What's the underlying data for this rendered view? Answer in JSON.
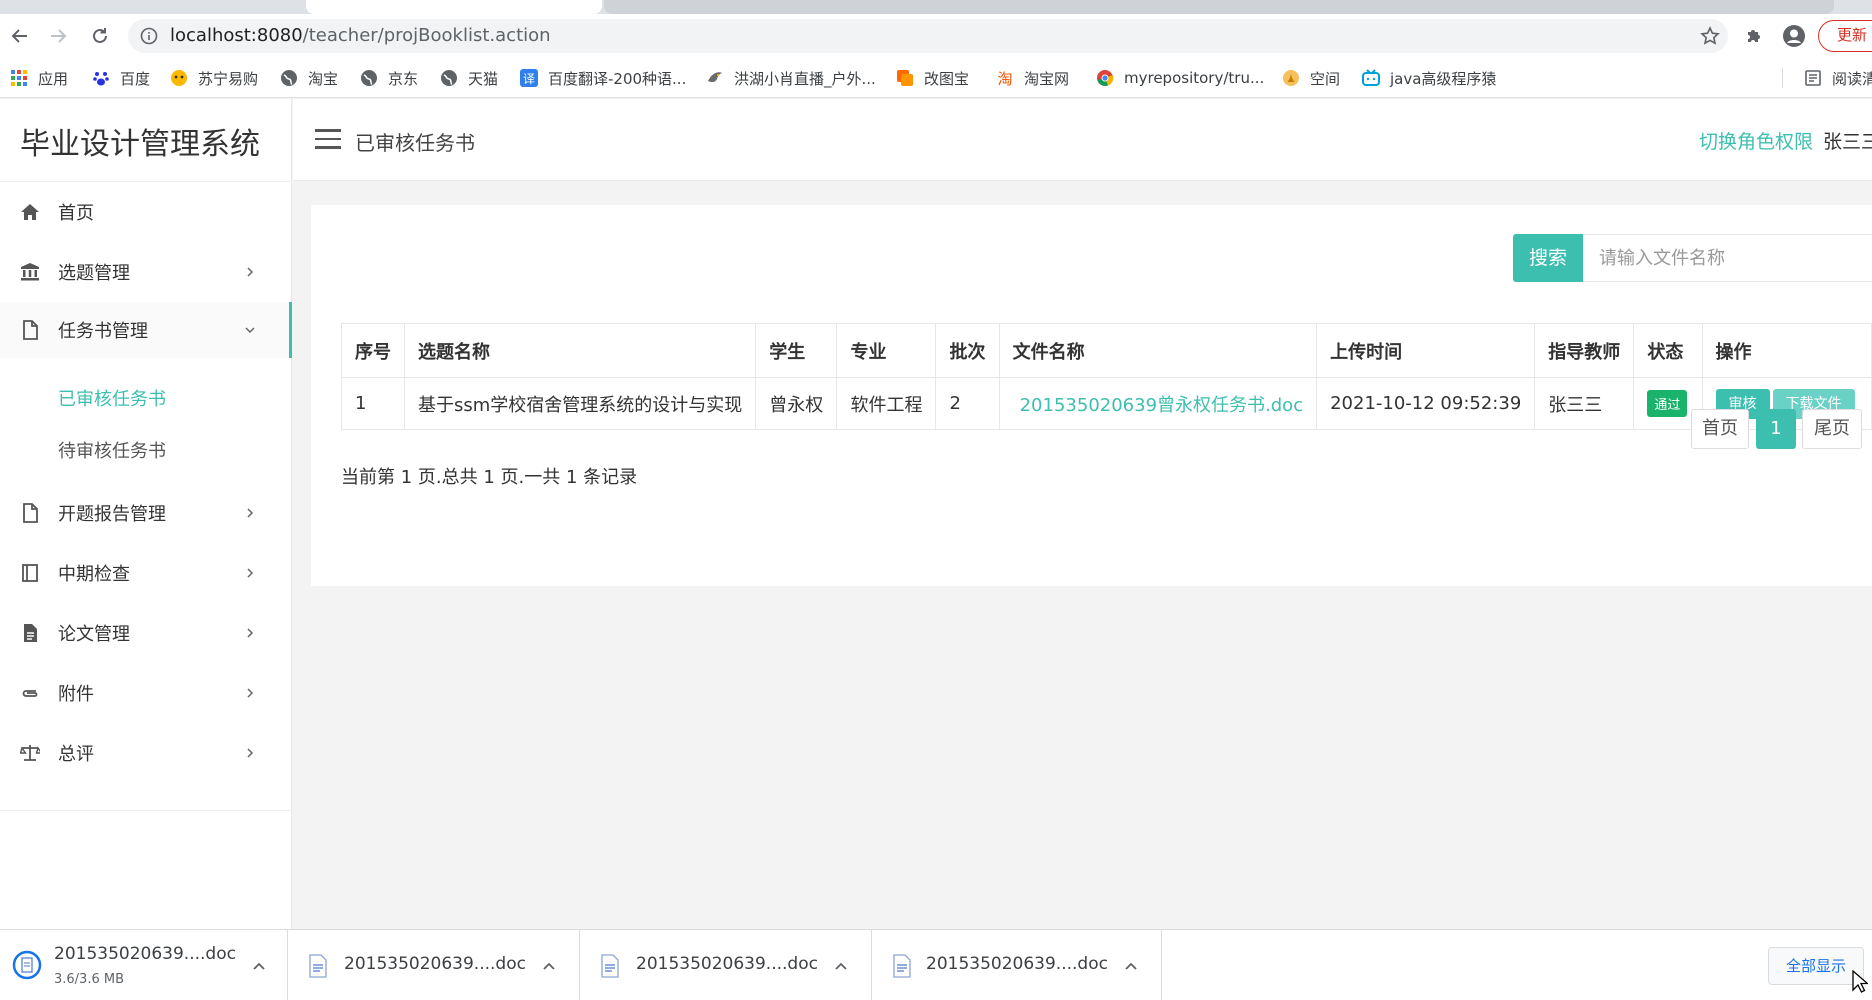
{
  "browser": {
    "url_host": "localhost:8080",
    "url_path": "/teacher/projBooklist.action",
    "update_label": "更新",
    "bookmarks": [
      {
        "label": "应用",
        "icon": "apps-grid-icon"
      },
      {
        "label": "百度",
        "icon": "baidu-paw-icon"
      },
      {
        "label": "苏宁易购",
        "icon": "suning-icon"
      },
      {
        "label": "淘宝",
        "icon": "globe-icon"
      },
      {
        "label": "京东",
        "icon": "globe-icon"
      },
      {
        "label": "天猫",
        "icon": "globe-icon"
      },
      {
        "label": "百度翻译-200种语...",
        "icon": "translate-icon"
      },
      {
        "label": "洪湖小肖直播_户外...",
        "icon": "bird-icon"
      },
      {
        "label": "改图宝",
        "icon": "gaitubao-icon"
      },
      {
        "label": "淘宝网",
        "icon": "taobao-icon"
      },
      {
        "label": "myrepository/tru...",
        "icon": "chrome-icon"
      },
      {
        "label": "空间",
        "icon": "qzone-icon"
      },
      {
        "label": "java高级程序猿",
        "icon": "bilibili-icon"
      }
    ],
    "reading_list_label": "阅读清"
  },
  "sidebar": {
    "brand": "毕业设计管理系统",
    "items": [
      {
        "label": "首页",
        "icon": "home-icon"
      },
      {
        "label": "选题管理",
        "icon": "bank-icon"
      },
      {
        "label": "任务书管理",
        "icon": "file-icon"
      },
      {
        "label": "开题报告管理",
        "icon": "file-icon"
      },
      {
        "label": "中期检查",
        "icon": "book-icon"
      },
      {
        "label": "论文管理",
        "icon": "document-icon"
      },
      {
        "label": "附件",
        "icon": "paperclip-icon"
      },
      {
        "label": "总评",
        "icon": "scale-icon"
      }
    ],
    "subitems": [
      "已审核任务书",
      "待审核任务书"
    ]
  },
  "topbar": {
    "title": "已审核任务书",
    "switch_role": "切换角色权限",
    "user": "张三三"
  },
  "search": {
    "button": "搜索",
    "placeholder": "请输入文件名称"
  },
  "table": {
    "headers": [
      "序号",
      "选题名称",
      "学生",
      "专业",
      "批次",
      "文件名称",
      "上传时间",
      "指导教师",
      "状态",
      "操作"
    ],
    "rows": [
      {
        "index": "1",
        "topic": "基于ssm学校宿舍管理系统的设计与实现",
        "student": "曾永权",
        "major": "软件工程",
        "batch": "2",
        "file": "201535020639曾永权任务书.doc",
        "upload_time": "2021-10-12 09:52:39",
        "teacher": "张三三",
        "status": "通过",
        "actions": [
          "审核",
          "下载文件"
        ]
      }
    ]
  },
  "pagination": {
    "info": "当前第 1 页.总共 1 页.一共 1 条记录",
    "first": "首页",
    "current": "1",
    "last": "尾页"
  },
  "downloads": {
    "items": [
      {
        "name": "201535020639....doc",
        "size": "3.6/3.6 MB"
      },
      {
        "name": "201535020639....doc"
      },
      {
        "name": "201535020639....doc"
      },
      {
        "name": "201535020639....doc"
      }
    ],
    "show_all": "全部显示"
  },
  "colors": {
    "accent": "#3dbfb0",
    "pass": "#1ab36b",
    "update": "#d93025"
  }
}
